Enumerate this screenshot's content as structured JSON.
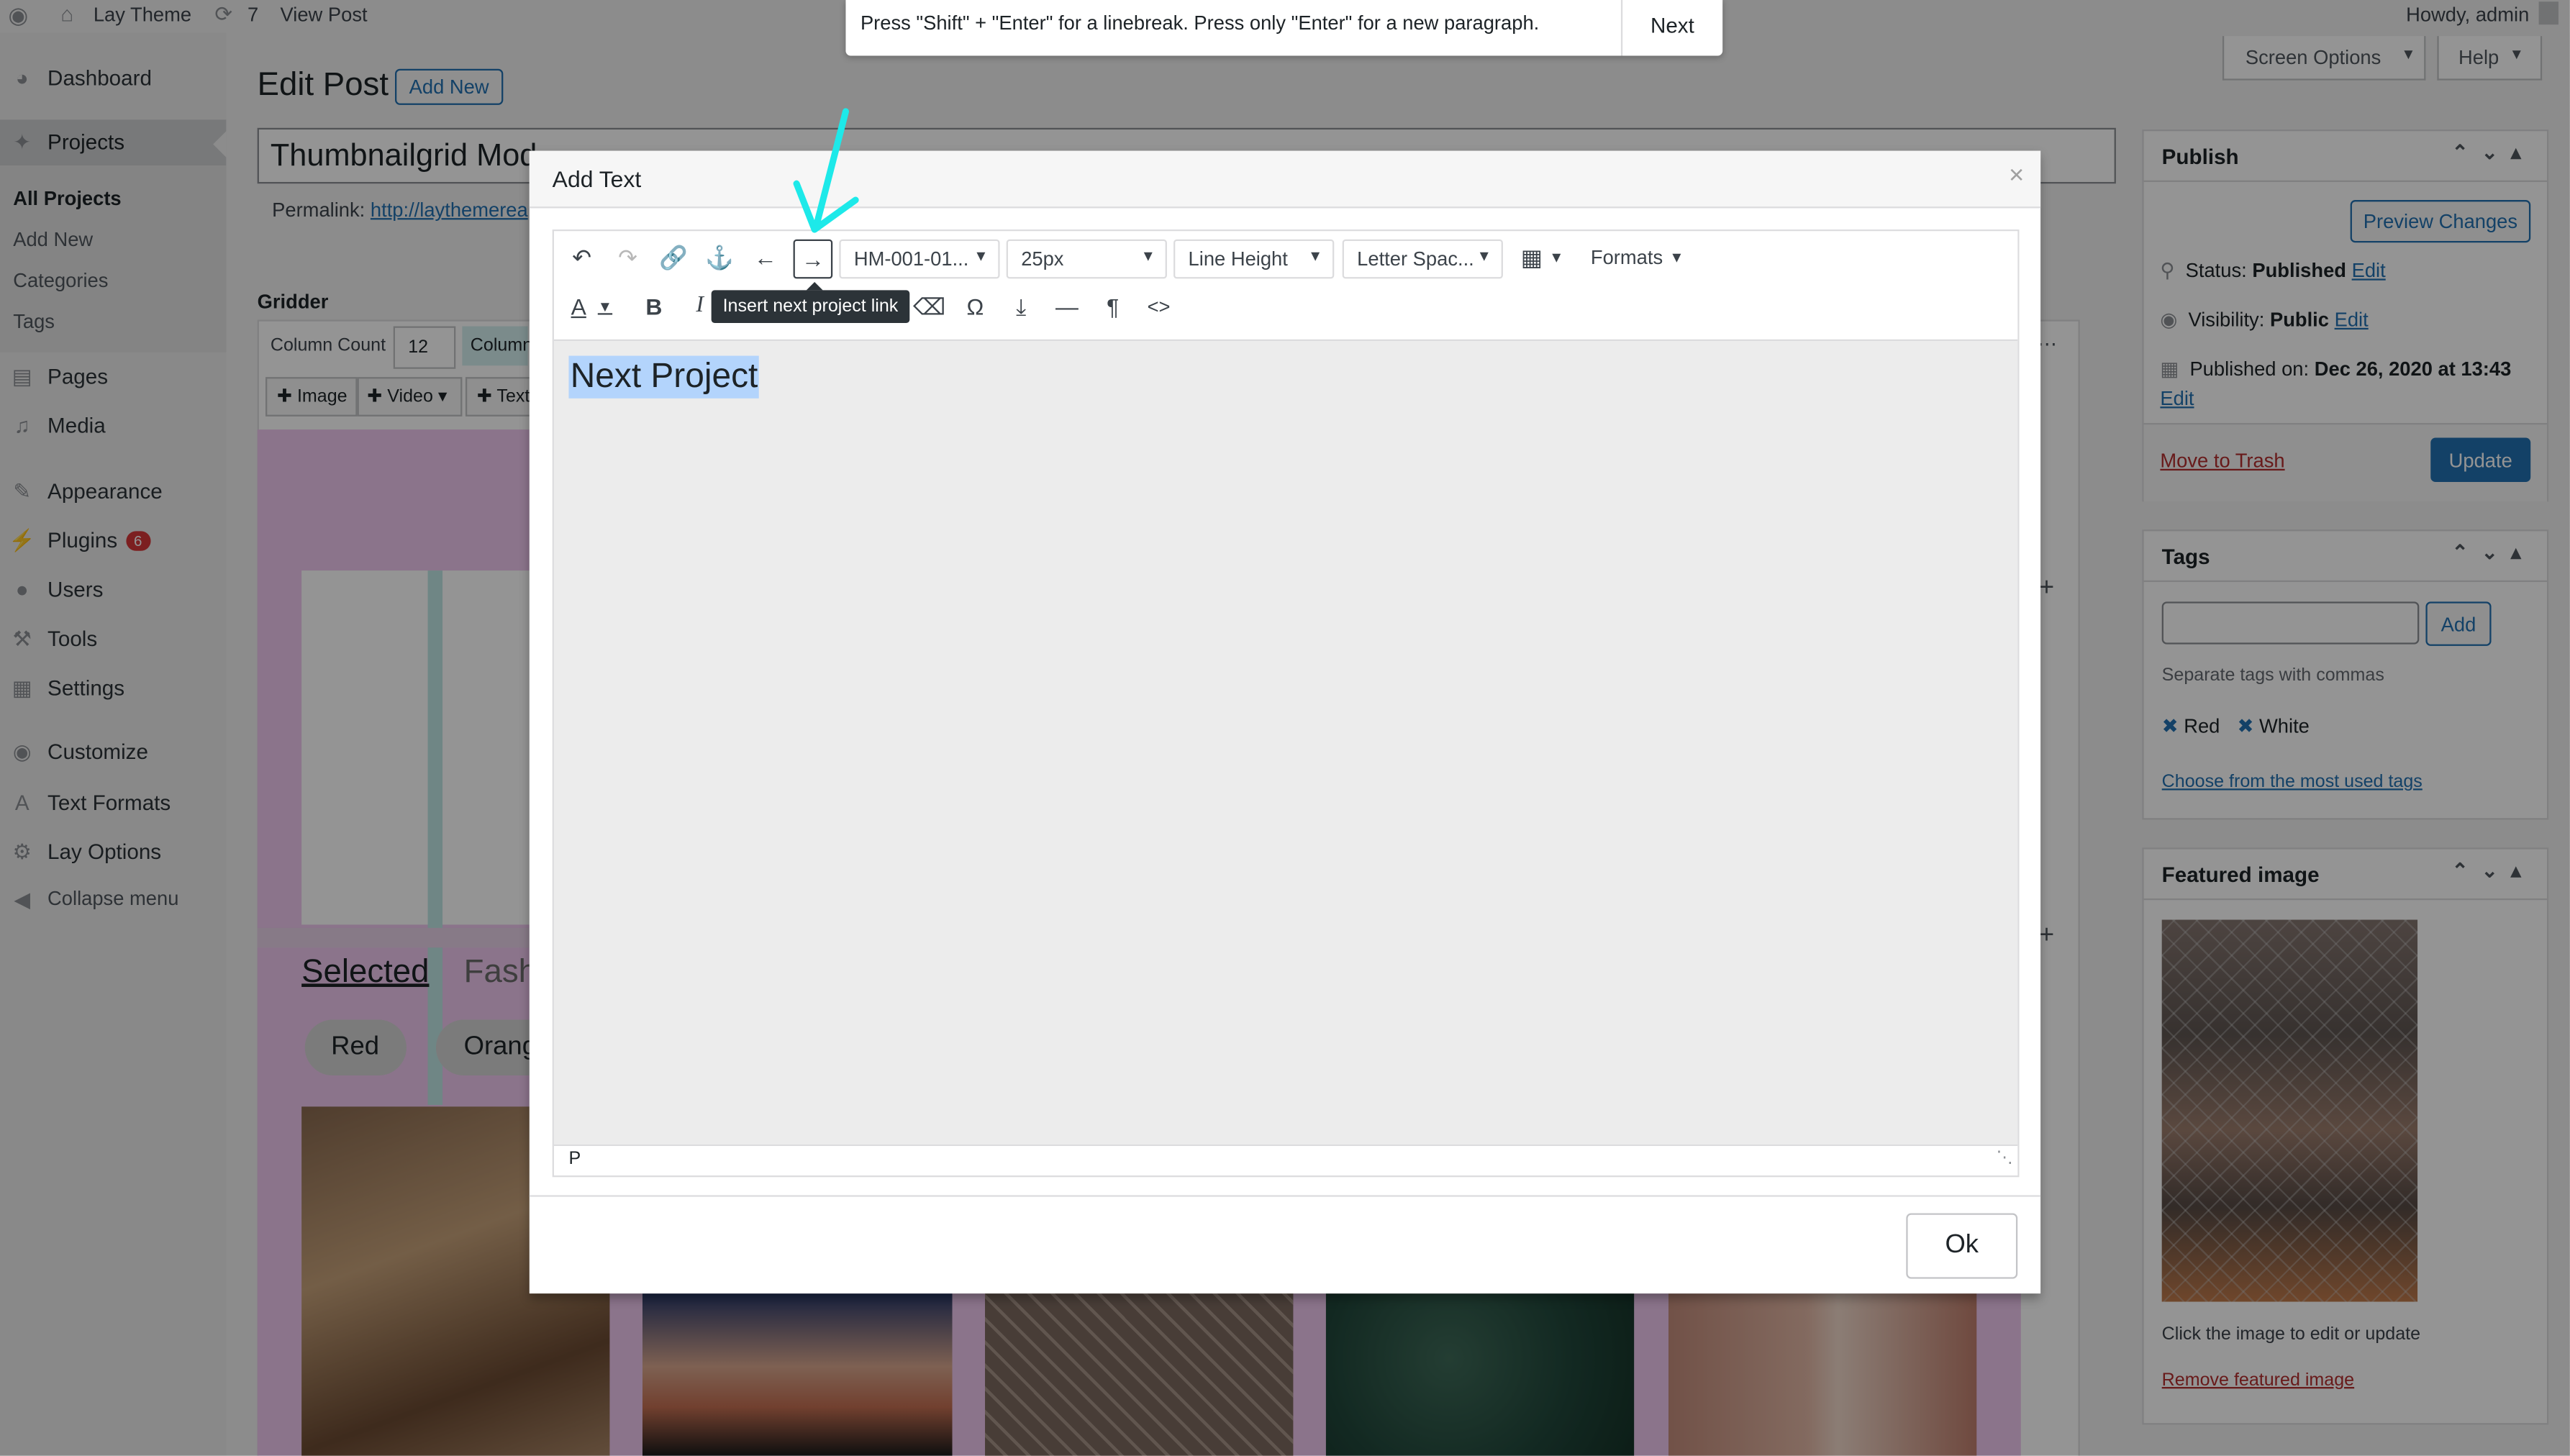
{
  "admin_bar": {
    "site_name": "Lay Theme",
    "updates_count": "7",
    "view_post": "View Post",
    "greeting": "Howdy, admin"
  },
  "notice": {
    "text": "Press \"Shift\" + \"Enter\" for a linebreak. Press only \"Enter\" for a new paragraph.",
    "next_label": "Next"
  },
  "sidebar": {
    "items": [
      {
        "label": "Dashboard",
        "icon": "dashboard-icon"
      },
      {
        "label": "Projects",
        "icon": "pin-icon"
      },
      {
        "label": "Pages",
        "icon": "pages-icon"
      },
      {
        "label": "Media",
        "icon": "media-icon"
      },
      {
        "label": "Appearance",
        "icon": "brush-icon"
      },
      {
        "label": "Plugins",
        "icon": "plug-icon",
        "badge": "6"
      },
      {
        "label": "Users",
        "icon": "user-icon"
      },
      {
        "label": "Tools",
        "icon": "wrench-icon"
      },
      {
        "label": "Settings",
        "icon": "settings-icon"
      },
      {
        "label": "Customize",
        "icon": "eye-icon"
      },
      {
        "label": "Text Formats",
        "icon": "letter-a-icon"
      },
      {
        "label": "Lay Options",
        "icon": "gear-icon"
      },
      {
        "label": "Collapse menu",
        "icon": "collapse-icon"
      }
    ],
    "submenu": [
      "All Projects",
      "Add New",
      "Categories",
      "Tags"
    ]
  },
  "header": {
    "title": "Edit Post",
    "add_new": "Add New",
    "screen_options": "Screen Options",
    "help": "Help"
  },
  "post": {
    "title_value": "Thumbnailgrid Mod",
    "permalink_label": "Permalink:",
    "permalink_url": "http://laythemerea"
  },
  "gridder": {
    "label": "Gridder",
    "column_count_label": "Column Count",
    "column_count_value": "12",
    "column_label": "Column",
    "add_image": "Image",
    "add_video": "Video",
    "add_text": "Text",
    "filter_selected": "Selected",
    "filter_fashion": "Fash",
    "tag_red": "Red",
    "tag_orange": "Orang"
  },
  "publish": {
    "title": "Publish",
    "preview_changes": "Preview Changes",
    "status_label": "Status:",
    "status_value": "Published",
    "visibility_label": "Visibility:",
    "visibility_value": "Public",
    "published_label": "Published on:",
    "published_value": "Dec 26, 2020 at 13:43",
    "edit": "Edit",
    "move_to_trash": "Move to Trash",
    "update": "Update"
  },
  "tags": {
    "title": "Tags",
    "add": "Add",
    "hint": "Separate tags with commas",
    "items": [
      "Red",
      "White"
    ],
    "choose_most_used": "Choose from the most used tags"
  },
  "featured_image": {
    "title": "Featured image",
    "hint": "Click the image to edit or update",
    "remove": "Remove featured image"
  },
  "modal": {
    "title": "Add Text",
    "project_select": "HM-001-01...",
    "font_size_select": "25px",
    "line_height_select": "Line Height",
    "letter_spacing_select": "Letter Spac...",
    "formats": "Formats",
    "tooltip": "Insert next project link",
    "content_text": "Next Project",
    "status_path": "P",
    "ok": "Ok"
  },
  "colors": {
    "accent": "#2271b1",
    "update_button": "#2271b1",
    "annotation_arrow": "#1de9e9",
    "selection_highlight": "#b3d4fc",
    "badge": "#d63638"
  }
}
